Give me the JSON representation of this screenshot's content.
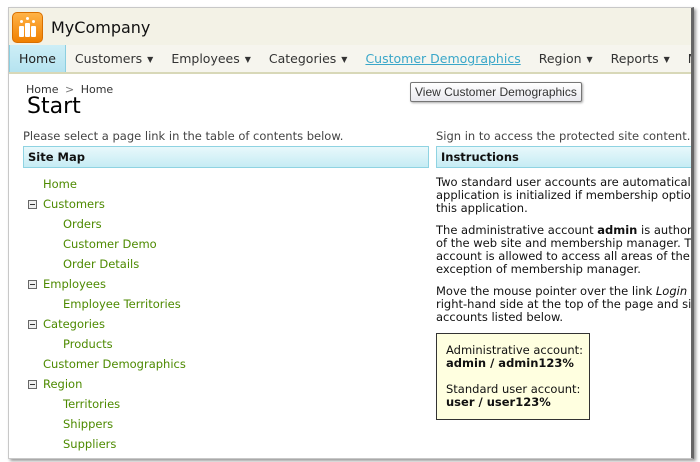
{
  "app": {
    "brand": "MyCompany"
  },
  "menu": [
    {
      "label": "Home",
      "active": true
    },
    {
      "label": "Customers",
      "caret": true
    },
    {
      "label": "Employees",
      "caret": true
    },
    {
      "label": "Categories",
      "caret": true
    },
    {
      "label": "Customer Demographics",
      "hover": true
    },
    {
      "label": "Region",
      "caret": true
    },
    {
      "label": "Reports",
      "caret": true
    },
    {
      "label": "Membe"
    }
  ],
  "tooltip": "View Customer Demographics",
  "breadcrumb": {
    "first": "Home",
    "sep": ">",
    "second": "Home"
  },
  "page_title": "Start",
  "left_intro": "Please select a page link in the table of contents below.",
  "right_intro": "Sign in to access the protected site content.",
  "sitemap": {
    "header": "Site Map",
    "items": [
      {
        "label": "Home",
        "level": 0
      },
      {
        "label": "Customers",
        "level": 0,
        "toggle": true
      },
      {
        "label": "Orders",
        "level": 1
      },
      {
        "label": "Customer Demo",
        "level": 1
      },
      {
        "label": "Order Details",
        "level": 1
      },
      {
        "label": "Employees",
        "level": 0,
        "toggle": true
      },
      {
        "label": "Employee Territories",
        "level": 1
      },
      {
        "label": "Categories",
        "level": 0,
        "toggle": true
      },
      {
        "label": "Products",
        "level": 1
      },
      {
        "label": "Customer Demographics",
        "level": 0
      },
      {
        "label": "Region",
        "level": 0,
        "toggle": true
      },
      {
        "label": "Territories",
        "level": 1
      },
      {
        "label": "Shippers",
        "level": 1
      },
      {
        "label": "Suppliers",
        "level": 1
      }
    ]
  },
  "instructions": {
    "header": "Instructions",
    "p1": [
      "Two standard user accounts are automatical",
      "application is initialized if membership optior",
      "this application."
    ],
    "p2a": "The administrative account ",
    "p2b": "admin",
    "p2c": " is author",
    "p2rest": [
      "of the web site and membership manager. T",
      "account is allowed to access all areas of the",
      "exception of membership manager."
    ],
    "p3a": "Move the mouse pointer over the link ",
    "p3b": "Login",
    "p3rest": [
      "right-hand side at the top of the page and si",
      "accounts listed below."
    ],
    "admin_label": "Administrative account:",
    "admin_creds": "admin / admin123%",
    "user_label": "Standard user account:",
    "user_creds": "user / user123%"
  }
}
